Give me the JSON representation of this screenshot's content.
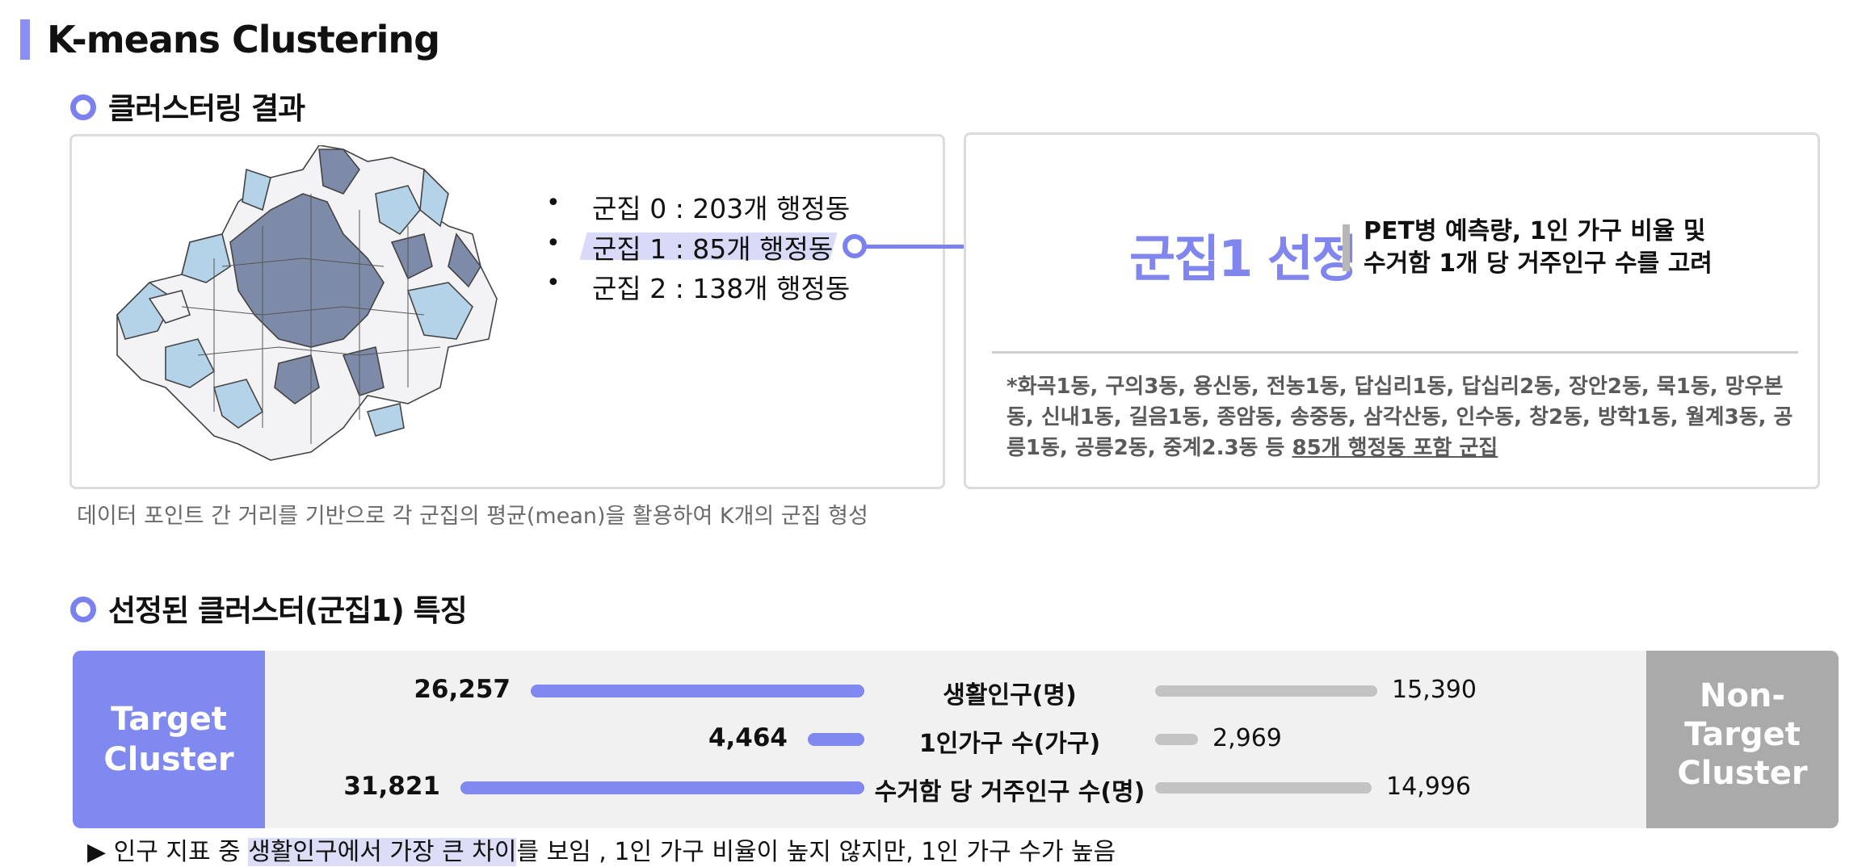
{
  "page_title": "K-means Clustering",
  "section1": {
    "title": "클러스터링 결과",
    "clusters": [
      {
        "bullet": "•",
        "label": "군집 0 :  203개 행정동"
      },
      {
        "bullet": "•",
        "label": "군집 1 :  85개 행정동"
      },
      {
        "bullet": "•",
        "label": "군집 2 : 138개 행정동"
      }
    ],
    "map_icon": "seoul-dong-cluster-map",
    "selected_title": "군집1 선정",
    "selected_note_line1": "PET병 예측량, 1인 가구 비율 및",
    "selected_note_line2": "수거함 1개 당 거주인구 수를 고려",
    "dong_list_text": "*화곡1동, 구의3동, 용신동, 전농1동, 답십리1동, 답십리2동, 장안2동, 묵1동, 망우본동, 신내1동, 길음1동, 종암동, 송중동, 삼각산동, 인수동, 창2동, 방학1동, 월계3동, 공릉1동, 공릉2동, 중계2.3동 등 ",
    "dong_list_emph": "85개 행정동 포함 군집",
    "caption": "데이터 포인트 간 거리를 기반으로 각 군집의 평균(mean)을 활용하여 K개의 군집 형성"
  },
  "section2": {
    "title": "선정된 클러스터(군집1) 특징",
    "target_label": [
      "Target",
      "Cluster"
    ],
    "nontarget_label": [
      "Non-",
      "Target",
      "Cluster"
    ],
    "metrics": [
      {
        "label": "생활인구(명)",
        "target": "26,257",
        "nontarget": "15,390",
        "target_value": 26257,
        "nontarget_value": 15390
      },
      {
        "label": "1인가구 수(가구)",
        "target": "4,464",
        "nontarget": "2,969",
        "target_value": 4464,
        "nontarget_value": 2969
      },
      {
        "label": "수거함 당 거주인구 수(명)",
        "target": "31,821",
        "nontarget": "14,996",
        "target_value": 31821,
        "nontarget_value": 14996
      }
    ],
    "footnote_prefix": "▶ 인구 지표 중 ",
    "footnote_hl": "생활인구에서 가장 큰 차이",
    "footnote_suffix": "를 보임 , 1인 가구 비율이 높지 않지만, 1인 가구 수가 높음"
  },
  "colors": {
    "accent": "#7b82ee",
    "target_box": "#8089f0",
    "nontarget_box": "#aaaaaa",
    "map_cluster1": "#7d8ba8",
    "map_cluster2": "#b5d3e8",
    "map_cluster0": "#f3f3f6"
  }
}
